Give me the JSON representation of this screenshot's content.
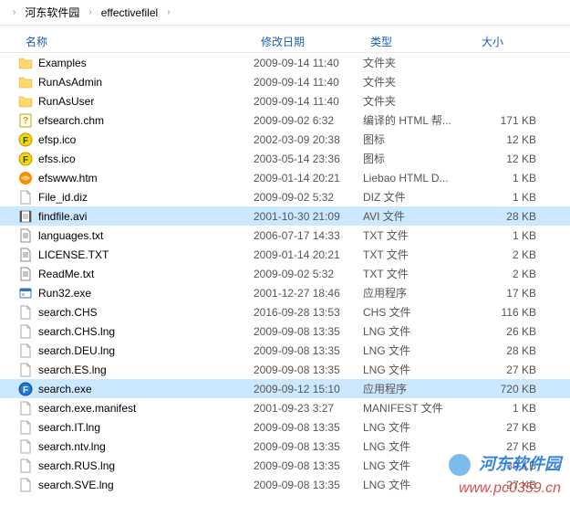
{
  "breadcrumb": {
    "parts": [
      "河东软件园",
      "effectivefilel"
    ]
  },
  "columns": {
    "name": "名称",
    "date": "修改日期",
    "type": "类型",
    "size": "大小"
  },
  "files": [
    {
      "icon": "folder",
      "name": "Examples",
      "date": "2009-09-14 11:40",
      "type": "文件夹",
      "size": "",
      "selected": false
    },
    {
      "icon": "folder",
      "name": "RunAsAdmin",
      "date": "2009-09-14 11:40",
      "type": "文件夹",
      "size": "",
      "selected": false
    },
    {
      "icon": "folder",
      "name": "RunAsUser",
      "date": "2009-09-14 11:40",
      "type": "文件夹",
      "size": "",
      "selected": false
    },
    {
      "icon": "chm",
      "name": "efsearch.chm",
      "date": "2009-09-02 6:32",
      "type": "编译的 HTML 帮...",
      "size": "171 KB",
      "selected": false
    },
    {
      "icon": "ico-f",
      "name": "efsp.ico",
      "date": "2002-03-09 20:38",
      "type": "图标",
      "size": "12 KB",
      "selected": false
    },
    {
      "icon": "ico-f",
      "name": "efss.ico",
      "date": "2003-05-14 23:36",
      "type": "图标",
      "size": "12 KB",
      "selected": false
    },
    {
      "icon": "htm",
      "name": "efswww.htm",
      "date": "2009-01-14 20:21",
      "type": "Liebao HTML D...",
      "size": "1 KB",
      "selected": false
    },
    {
      "icon": "file",
      "name": "File_id.diz",
      "date": "2009-09-02 5:32",
      "type": "DIZ 文件",
      "size": "1 KB",
      "selected": false
    },
    {
      "icon": "avi",
      "name": "findfile.avi",
      "date": "2001-10-30 21:09",
      "type": "AVI 文件",
      "size": "28 KB",
      "selected": true
    },
    {
      "icon": "txt",
      "name": "languages.txt",
      "date": "2006-07-17 14:33",
      "type": "TXT 文件",
      "size": "1 KB",
      "selected": false
    },
    {
      "icon": "txt",
      "name": "LICENSE.TXT",
      "date": "2009-01-14 20:21",
      "type": "TXT 文件",
      "size": "2 KB",
      "selected": false
    },
    {
      "icon": "txt",
      "name": "ReadMe.txt",
      "date": "2009-09-02 5:32",
      "type": "TXT 文件",
      "size": "2 KB",
      "selected": false
    },
    {
      "icon": "exe",
      "name": "Run32.exe",
      "date": "2001-12-27 18:46",
      "type": "应用程序",
      "size": "17 KB",
      "selected": false
    },
    {
      "icon": "file",
      "name": "search.CHS",
      "date": "2016-09-28 13:53",
      "type": "CHS 文件",
      "size": "116 KB",
      "selected": false
    },
    {
      "icon": "file",
      "name": "search.CHS.lng",
      "date": "2009-09-08 13:35",
      "type": "LNG 文件",
      "size": "26 KB",
      "selected": false
    },
    {
      "icon": "file",
      "name": "search.DEU.lng",
      "date": "2009-09-08 13:35",
      "type": "LNG 文件",
      "size": "28 KB",
      "selected": false
    },
    {
      "icon": "file",
      "name": "search.ES.lng",
      "date": "2009-09-08 13:35",
      "type": "LNG 文件",
      "size": "27 KB",
      "selected": false
    },
    {
      "icon": "exe-f",
      "name": "search.exe",
      "date": "2009-09-12 15:10",
      "type": "应用程序",
      "size": "720 KB",
      "selected": true
    },
    {
      "icon": "file",
      "name": "search.exe.manifest",
      "date": "2001-09-23 3:27",
      "type": "MANIFEST 文件",
      "size": "1 KB",
      "selected": false
    },
    {
      "icon": "file",
      "name": "search.IT.lng",
      "date": "2009-09-08 13:35",
      "type": "LNG 文件",
      "size": "27 KB",
      "selected": false
    },
    {
      "icon": "file",
      "name": "search.ntv.lng",
      "date": "2009-09-08 13:35",
      "type": "LNG 文件",
      "size": "27 KB",
      "selected": false
    },
    {
      "icon": "file",
      "name": "search.RUS.lng",
      "date": "2009-09-08 13:35",
      "type": "LNG 文件",
      "size": "39 KB",
      "selected": false
    },
    {
      "icon": "file",
      "name": "search.SVE.lng",
      "date": "2009-09-08 13:35",
      "type": "LNG 文件",
      "size": "27 KB",
      "selected": false
    }
  ],
  "watermark": {
    "title": "河东软件园",
    "url": "www.pc0359.cn"
  }
}
